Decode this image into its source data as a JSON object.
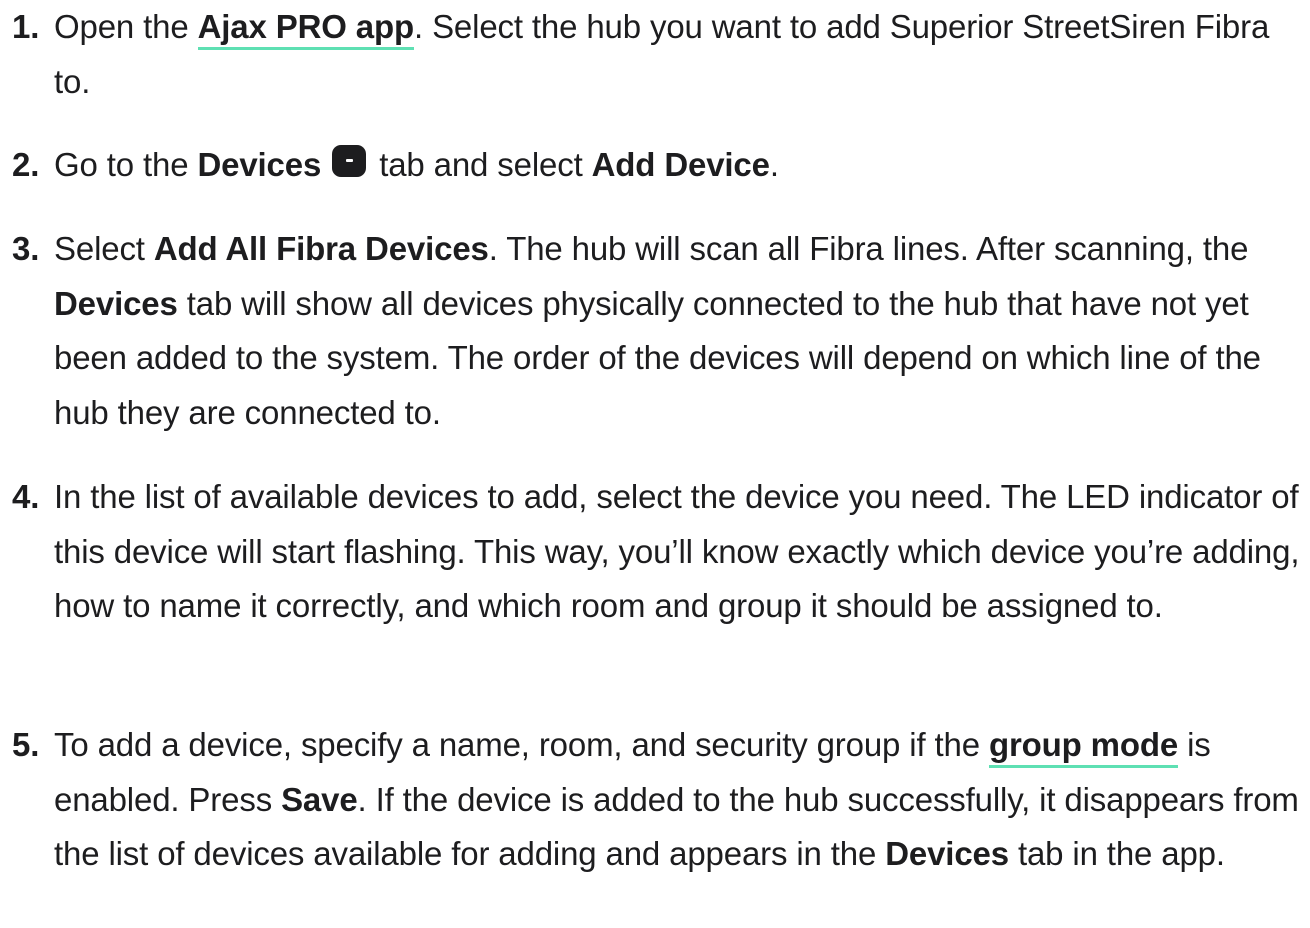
{
  "steps": [
    {
      "number": "1.",
      "before_link": "Open the ",
      "link": "Ajax PRO app",
      "after_link": ". Select the hub you want to add Superior StreetSiren Fibra to."
    },
    {
      "number": "2.",
      "t1": "Go to the ",
      "b1": "Devices",
      "icon": "devices-tab-icon",
      "t2": " tab and select ",
      "b2": "Add Device",
      "t3": "."
    },
    {
      "number": "3.",
      "t1": "Select ",
      "b1": "Add All Fibra Devices",
      "t2": ". The hub will scan all Fibra lines. After scanning, the ",
      "b2": "Devices",
      "t3": " tab will show all devices physically connected to the hub that have not yet been added to the system. The order of the devices will depend on which line of the hub they are connected to."
    },
    {
      "number": "4.",
      "text": "In the list of available devices to add, select the device you need. The LED indicator of this device will start flashing. This way, you’ll know exactly which device you’re adding, how to name it correctly, and which room and group it should be assigned to."
    },
    {
      "number": "5.",
      "t1": "To add a device, specify a name, room, and security group if the ",
      "link": "group mode",
      "t2": " is enabled. Press ",
      "b1": "Save",
      "t3": ". If the device is added to the hub successfully, it disappears from the list of devices available for adding and appears in the ",
      "b2": "Devices",
      "t4": " tab in the app."
    }
  ],
  "colors": {
    "text": "#1d1d1f",
    "link_underline": "#5ee0b3",
    "background": "#ffffff"
  }
}
